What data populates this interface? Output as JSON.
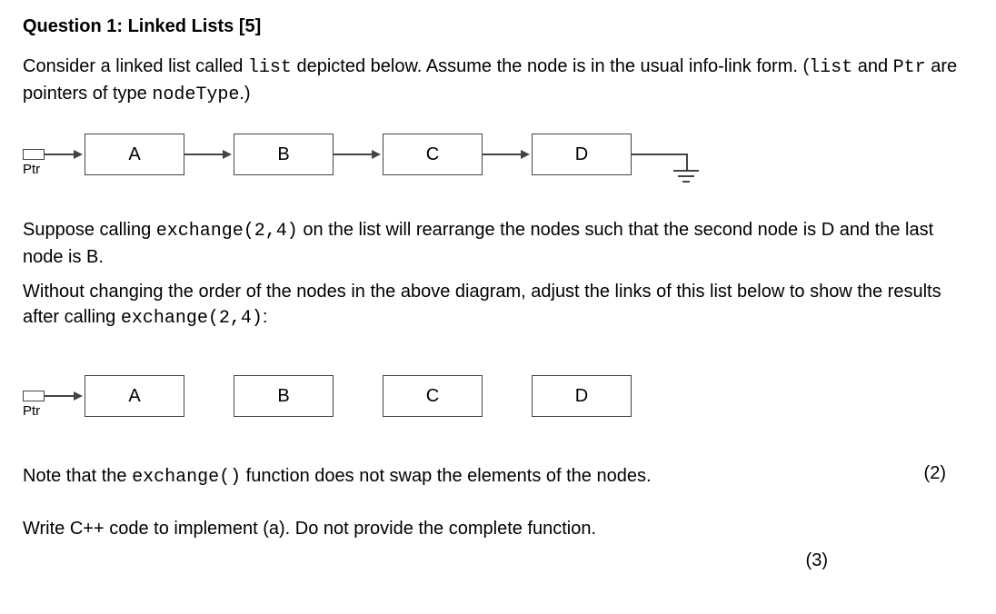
{
  "heading": "Question 1: Linked Lists [5]",
  "intro": {
    "line1_a": "Consider a linked list called ",
    "line1_code1": "list",
    "line1_b": " depicted below. Assume the node is in the usual info-link form. (",
    "line1_code2": "list",
    "line1_c": " and ",
    "line1_code3": "Ptr",
    "line1_d": " are pointers of type ",
    "line1_code4": "nodeType",
    "line1_e": ".)"
  },
  "diagram1": {
    "ptr_label": "Ptr",
    "nodes": [
      "A",
      "B",
      "C",
      "D"
    ]
  },
  "mid": {
    "p1_a": "Suppose calling ",
    "p1_code": "exchange(2,4)",
    "p1_b": " on the list will rearrange the nodes such that the second node is D and the last node is B.",
    "p2_a": "Without changing the order of the nodes in the above diagram, adjust the links of this list below to show the results after calling ",
    "p2_code": "exchange(2,4)",
    "p2_b": ":"
  },
  "diagram2": {
    "ptr_label": "Ptr",
    "nodes": [
      "A",
      "B",
      "C",
      "D"
    ]
  },
  "marks1": "(2)",
  "note": {
    "a": "Note that the ",
    "code": "exchange()",
    "b": " function  does not swap the elements of the nodes."
  },
  "task": "Write C++ code to implement (a). Do not provide the complete function.",
  "marks2": "(3)"
}
